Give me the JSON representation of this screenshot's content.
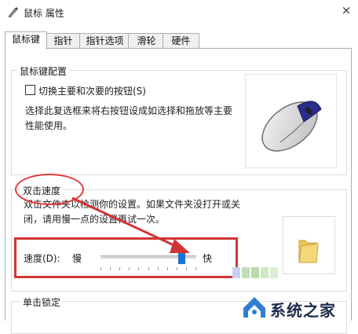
{
  "window": {
    "title": "鼠标 属性",
    "close_glyph": "×"
  },
  "tabs": [
    {
      "label": "鼠标键",
      "active": true
    },
    {
      "label": "指针",
      "active": false
    },
    {
      "label": "指针选项",
      "active": false
    },
    {
      "label": "滑轮",
      "active": false
    },
    {
      "label": "硬件",
      "active": false
    }
  ],
  "button_config": {
    "title": "鼠标键配置",
    "checkbox_label": "切换主要和次要的按钮(S)",
    "checkbox_checked": false,
    "description_line1": "选择此复选框来将右按钮设成如选择和拖放等主要",
    "description_line2": "性能使用。"
  },
  "double_click": {
    "title": "双击速度",
    "description_line1": "双击文件夹以检测你的设置。如果文件夹没打开或关",
    "description_line2": "闭，请用慢一点的设置再试一次。",
    "speed_label": "速度(D):",
    "slow_label": "慢",
    "fast_label": "快",
    "speed_value_fraction": 0.88
  },
  "click_lock": {
    "title": "单击锁定"
  },
  "watermark": {
    "text": "系统之家"
  },
  "colors": {
    "accent": "#1875d1",
    "annotation_red": "#d23434"
  }
}
